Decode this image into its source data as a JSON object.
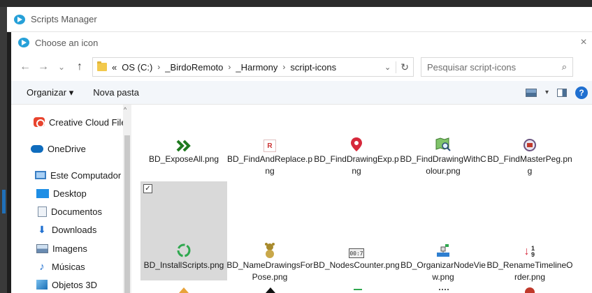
{
  "window": {
    "title": "Scripts Manager"
  },
  "dialog": {
    "title": "Choose an icon",
    "close_glyph": "×"
  },
  "nav": {
    "back": "←",
    "forward": "→",
    "recent": "⌄",
    "up": "↑",
    "breadcrumbs": [
      "«",
      "OS (C:)",
      "_BirdoRemoto",
      "_Harmony",
      "script-icons"
    ],
    "separator": "›",
    "dropdown": "⌄",
    "refresh": "↻",
    "search_placeholder": "Pesquisar script-icons",
    "search_glyph": "⌕"
  },
  "toolbar": {
    "organize": "Organizar ▾",
    "new_folder": "Nova pasta",
    "dropdown": "▾",
    "help": "?"
  },
  "sidebar": {
    "scroll_up": "^",
    "items": [
      {
        "label": "Creative Cloud Files",
        "icon": "creative-cloud-icon"
      },
      {
        "label": "OneDrive",
        "icon": "onedrive-icon"
      },
      {
        "label": "Este Computador",
        "icon": "computer-icon"
      },
      {
        "label": "Desktop",
        "icon": "desktop-icon"
      },
      {
        "label": "Documentos",
        "icon": "documents-icon"
      },
      {
        "label": "Downloads",
        "icon": "downloads-icon"
      },
      {
        "label": "Imagens",
        "icon": "pictures-icon"
      },
      {
        "label": "Músicas",
        "icon": "music-icon"
      },
      {
        "label": "Objetos 3D",
        "icon": "objects-3d-icon"
      }
    ]
  },
  "files": [
    {
      "name": "BD_ExposeAll.png",
      "icon": "double-chevron-icon"
    },
    {
      "name": "BD_FindAndReplace.png",
      "icon": "letter-r-icon",
      "icon_text": "R"
    },
    {
      "name": "BD_FindDrawingExp.png",
      "icon": "map-pin-icon"
    },
    {
      "name": "BD_FindDrawingWithColour.png",
      "icon": "map-search-icon"
    },
    {
      "name": "BD_FindMasterPeg.png",
      "icon": "magnifier-peg-icon"
    },
    {
      "name": "BD_InstallScripts.png",
      "icon": "refresh-circle-icon",
      "selected": true,
      "check": "✓"
    },
    {
      "name": "BD_NameDrawingsForPose.png",
      "icon": "bear-icon"
    },
    {
      "name": "BD_NodesCounter.png",
      "icon": "counter-icon",
      "icon_text": "00:7"
    },
    {
      "name": "BD_OrganizarNodeView.png",
      "icon": "nodes-icon"
    },
    {
      "name": "BD_RenameTimelineOrder.png",
      "icon": "sort-numbers-icon",
      "icon_text": "1 9"
    }
  ]
}
